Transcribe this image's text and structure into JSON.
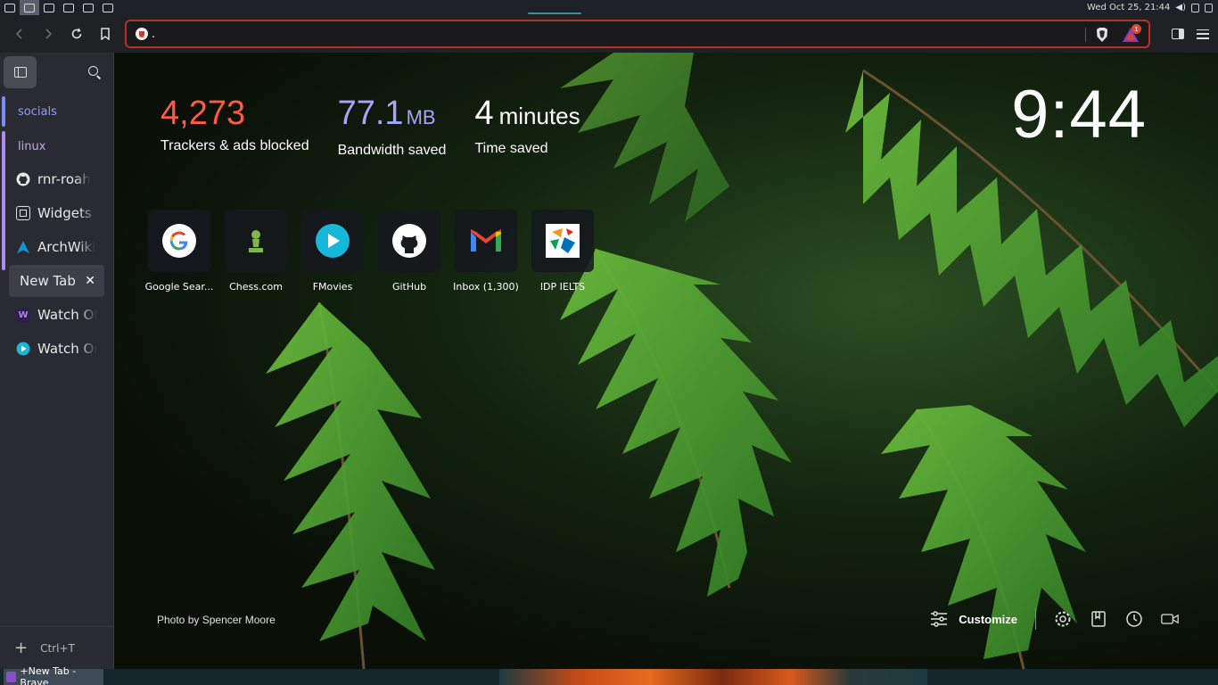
{
  "system_bar": {
    "datetime": "Wed Oct 25, 21:44"
  },
  "toolbar": {
    "url_value": ".",
    "rewards_badge": "1"
  },
  "sidebar": {
    "groups": [
      {
        "label": "socials",
        "color": "#7c8cf8",
        "tabs": []
      },
      {
        "label": "linux",
        "color": "#b08cf0",
        "tabs": [
          {
            "label": "rnr-roah",
            "icon": "github-icon"
          },
          {
            "label": "Widgets f",
            "icon": "widgets-icon"
          },
          {
            "label": "ArchWiki",
            "icon": "archwiki-icon"
          }
        ]
      }
    ],
    "active_tab": {
      "label": "New Tab",
      "close": "✕"
    },
    "ungrouped_tabs": [
      {
        "label": "Watch ON",
        "icon": "w-icon"
      },
      {
        "label": "Watch On",
        "icon": "play-icon"
      }
    ],
    "new_tab_shortcut": "Ctrl+T"
  },
  "stats": {
    "trackers": {
      "value": "4,273",
      "label": "Trackers & ads blocked",
      "color": "#ff5a42"
    },
    "bandwidth": {
      "value": "77.1",
      "unit": "MB",
      "label": "Bandwidth saved",
      "color": "#a5a6f8"
    },
    "time": {
      "value": "4",
      "unit": "minutes",
      "label": "Time saved"
    }
  },
  "clock": "9:44",
  "top_sites": [
    {
      "name": "Google Sear...",
      "icon": "google-icon"
    },
    {
      "name": "Chess.com",
      "icon": "chess-icon"
    },
    {
      "name": "FMovies",
      "icon": "fmovies-icon"
    },
    {
      "name": "GitHub",
      "icon": "github-icon"
    },
    {
      "name": "Inbox (1,300)",
      "icon": "gmail-icon"
    },
    {
      "name": "IDP IELTS",
      "icon": "idp-icon"
    }
  ],
  "photo_credit": {
    "prefix": "Photo by",
    "author": "Spencer Moore"
  },
  "customize_label": "Customize",
  "taskbar": {
    "task_label": "+New Tab - Brave"
  }
}
